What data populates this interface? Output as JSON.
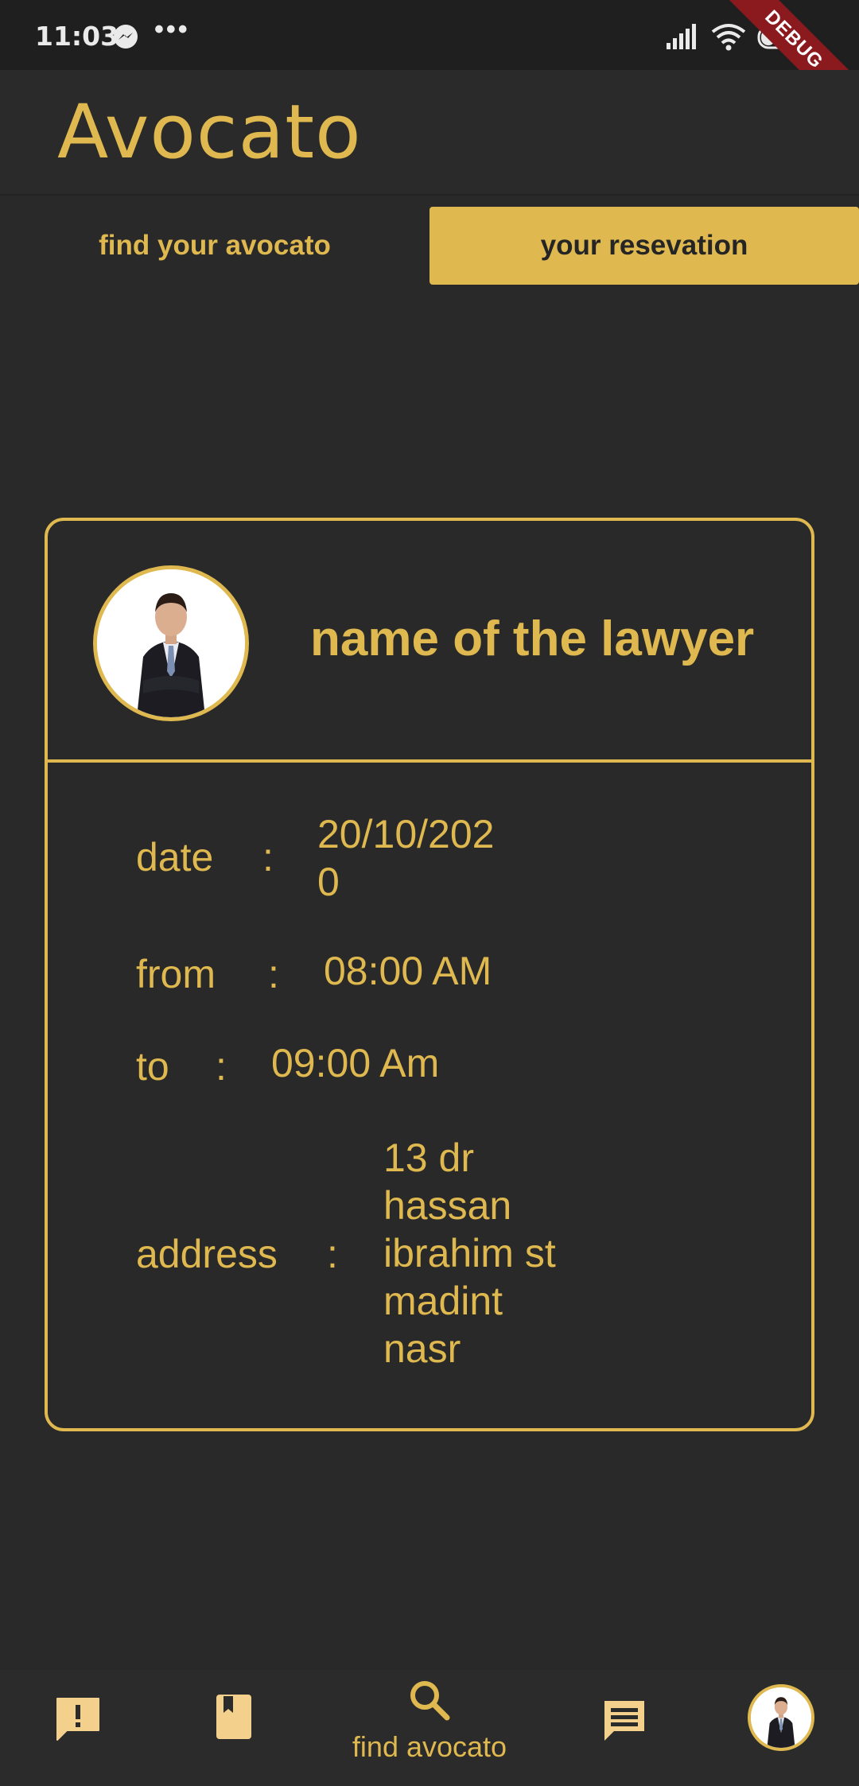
{
  "status_bar": {
    "time": "11:03",
    "more": "•••",
    "battery": "28",
    "debug_banner": "DEBUG",
    "icons": [
      "messenger-icon",
      "signal-icon",
      "wifi-icon",
      "battery-icon"
    ]
  },
  "app": {
    "title": "Avocato"
  },
  "tabs": [
    {
      "label": "find your avocato",
      "active": false
    },
    {
      "label": "your resevation",
      "active": true
    }
  ],
  "reservation": {
    "lawyer_name": "name of the lawyer",
    "date_label": "date",
    "date_value": "20/10/202\n0",
    "from_label": "from",
    "from_value": "08:00 AM",
    "to_label": "to",
    "to_value": "09:00 Am",
    "address_label": "address",
    "address_value": "13 dr\nhassan\nibrahim st\nmadint\nnasr",
    "separator": ":"
  },
  "bottom_nav": {
    "items": [
      {
        "icon": "report-icon"
      },
      {
        "icon": "bookmark-book-icon"
      },
      {
        "icon": "search-icon",
        "label": "find avocato",
        "active": true
      },
      {
        "icon": "chat-icon"
      },
      {
        "icon": "profile-avatar"
      }
    ]
  },
  "colors": {
    "accent": "#dfb94f",
    "background": "#292929",
    "status_bar": "#1f1f1f",
    "debug": "#8b1a1f"
  }
}
